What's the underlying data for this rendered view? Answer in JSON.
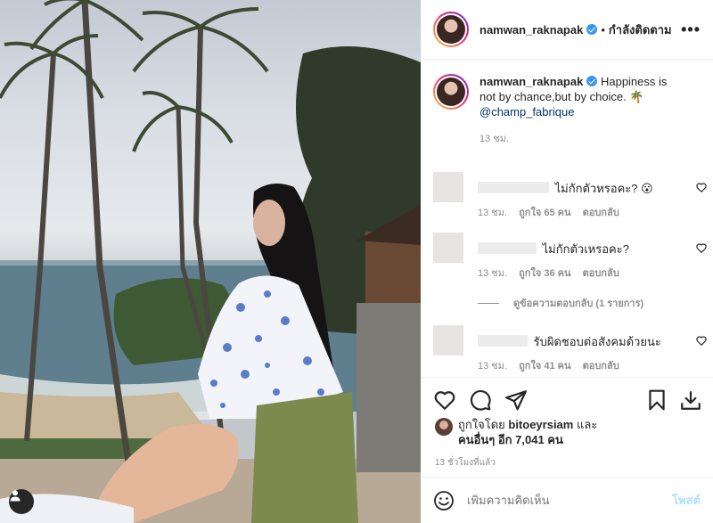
{
  "post": {
    "username": "namwan_raknapak",
    "follow_label": "กำลังติดตาม",
    "more_label": "•••",
    "caption_text": "Happiness is not by chance,but by choice. 🌴",
    "caption_mention": "@champ_fabrique",
    "caption_time": "13 ชม."
  },
  "comments": [
    {
      "text": "ไม่กักตัวหรอคะ? 😮",
      "time": "13 ชม.",
      "likes": "ถูกใจ 65 คน",
      "reply": "ตอบกลับ"
    },
    {
      "text": "ไม่กักตัวเหรอคะ?",
      "time": "13 ชม.",
      "likes": "ถูกใจ 36 คน",
      "reply": "ตอบกลับ"
    },
    {
      "text": "รับผิดชอบต่อสังคมด้วยนะ",
      "time": "13 ชม.",
      "likes": "ถูกใจ 41 คน",
      "reply": "ตอบกลับ"
    }
  ],
  "view_replies": "ดูข้อความตอบกลับ (1 รายการ)",
  "likes": {
    "prefix": "ถูกใจโดย",
    "user": "bitoeyrsiam",
    "suffix": "และ",
    "others": "คนอื่นๆ อีก 7,041 คน"
  },
  "time_ago": "13 ชั่วโมงที่แล้ว",
  "comment_box": {
    "placeholder": "เพิ่มความคิดเห็น",
    "post_label": "โพสต์"
  },
  "icons": [
    "heart-icon",
    "comment-icon",
    "share-icon",
    "bookmark-icon",
    "download-icon",
    "emoji-icon",
    "user-icon",
    "verified-icon"
  ],
  "colors": {
    "verified": "#3897f0",
    "post_button": "#b2dffc",
    "mention": "#00376b"
  }
}
